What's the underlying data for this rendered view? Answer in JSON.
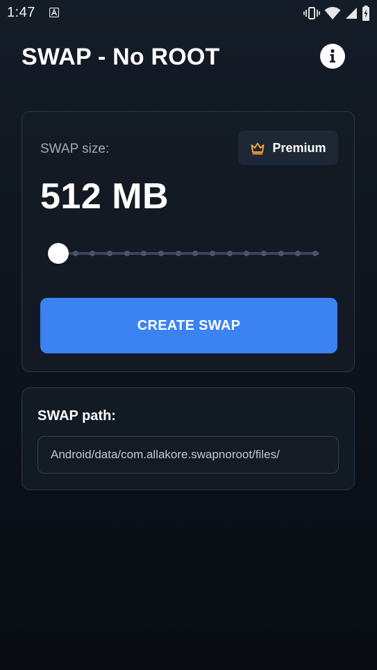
{
  "status_bar": {
    "time": "1:47",
    "icons": [
      "accessibility-a-icon",
      "vibrate-icon",
      "wifi-icon",
      "signal-icon",
      "battery-charging-icon"
    ]
  },
  "header": {
    "title": "SWAP - No ROOT",
    "info_icon": "info-icon"
  },
  "size_card": {
    "label": "SWAP size:",
    "premium_label": "Premium",
    "premium_icon": "crown-icon",
    "value": "512 MB",
    "slider": {
      "steps": 16,
      "selected_index": 0
    },
    "create_label": "CREATE SWAP"
  },
  "path_card": {
    "label": "SWAP path:",
    "value": "Android/data/com.allakore.swapnoroot/files/"
  },
  "colors": {
    "background": "#0d131c",
    "card": "#141b25",
    "card_border": "#2c3746",
    "accent": "#3b82f3",
    "premium_icon": "#f2a33a",
    "muted_text": "#a3abb7"
  }
}
